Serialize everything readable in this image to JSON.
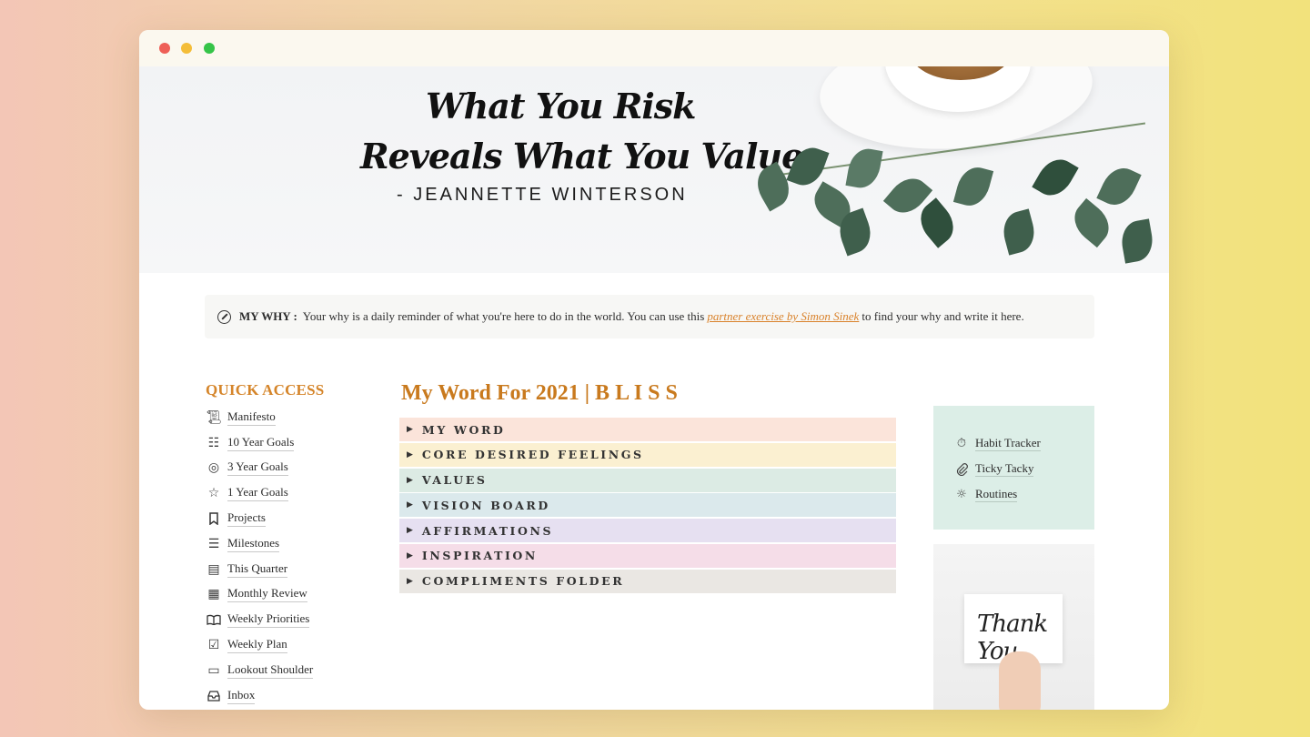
{
  "cover": {
    "quote_line1": "What You Risk",
    "quote_line2": "Reveals What You Value",
    "author": "- JEANNETTE WINTERSON"
  },
  "why": {
    "label": "MY WHY :",
    "text_before": "Your why is a daily reminder of what you're here to do in the world. You can use this",
    "link": "partner exercise by Simon Sinek",
    "text_after": "to find your why and write it here."
  },
  "quick_access": {
    "title": "QUICK ACCESS",
    "items": [
      {
        "label": "Manifesto",
        "icon": "scroll-icon"
      },
      {
        "label": "10 Year Goals",
        "icon": "map-icon"
      },
      {
        "label": "3 Year Goals",
        "icon": "target-icon"
      },
      {
        "label": "1 Year Goals",
        "icon": "star-icon"
      },
      {
        "label": "Projects",
        "icon": "bookmark-icon"
      },
      {
        "label": "Milestones",
        "icon": "list-icon"
      },
      {
        "label": "This Quarter",
        "icon": "newspaper-icon"
      },
      {
        "label": "Monthly Review",
        "icon": "calendar-icon"
      },
      {
        "label": "Weekly Priorities",
        "icon": "book-icon"
      },
      {
        "label": "Weekly Plan",
        "icon": "checklist-icon"
      },
      {
        "label": "Lookout Shoulder",
        "icon": "map-scroll-icon"
      },
      {
        "label": "Inbox",
        "icon": "inbox-icon"
      }
    ]
  },
  "word": {
    "title": "My Word For 2021 | B L I S S",
    "toggles": [
      {
        "label": "MY WORD",
        "color": "#fbe4da"
      },
      {
        "label": "CORE DESIRED FEELINGS",
        "color": "#fbf0d1"
      },
      {
        "label": "VALUES",
        "color": "#dcebe4"
      },
      {
        "label": "VISION BOARD",
        "color": "#dbe9ec"
      },
      {
        "label": "AFFIRMATIONS",
        "color": "#e6e0f1"
      },
      {
        "label": "INSPIRATION",
        "color": "#f5dde8"
      },
      {
        "label": "COMPLIMENTS FOLDER",
        "color": "#eae7e3"
      }
    ]
  },
  "side": {
    "items": [
      {
        "label": "Habit Tracker",
        "icon": "stopwatch-icon"
      },
      {
        "label": "Ticky Tacky",
        "icon": "paperclip-icon"
      },
      {
        "label": "Routines",
        "icon": "sun-icon"
      }
    ]
  },
  "thank_you": {
    "text": "Thank You"
  }
}
